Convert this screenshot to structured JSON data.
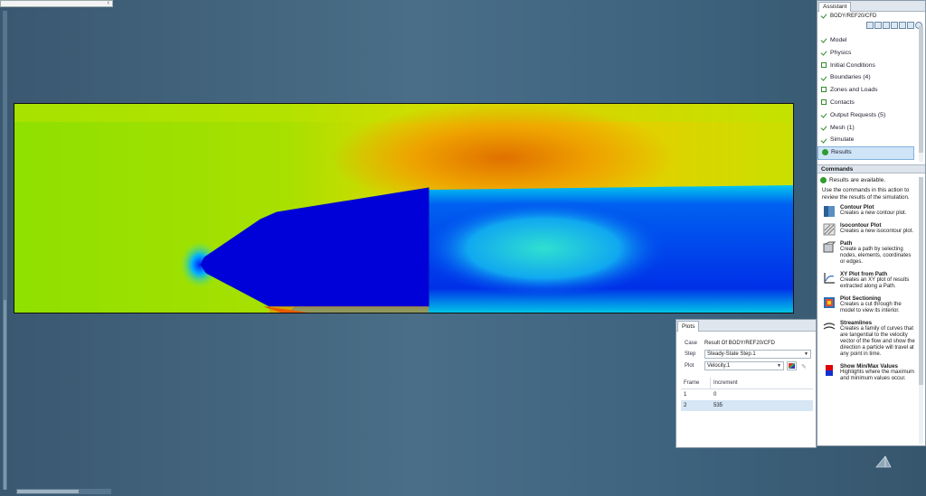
{
  "assistant": {
    "tab_label": "Assistant",
    "path": "BODY/REF20/CFD",
    "steps": [
      {
        "label": "Model",
        "state": "done"
      },
      {
        "label": "Physics",
        "state": "done"
      },
      {
        "label": "Initial Conditions",
        "state": "open"
      },
      {
        "label": "Boundaries (4)",
        "state": "done"
      },
      {
        "label": "Zones and Loads",
        "state": "open"
      },
      {
        "label": "Contacts",
        "state": "open"
      },
      {
        "label": "Output Requests (5)",
        "state": "done"
      },
      {
        "label": "Mesh (1)",
        "state": "done"
      },
      {
        "label": "Simulate",
        "state": "done"
      },
      {
        "label": "Results",
        "state": "active"
      }
    ],
    "commands_header": "Commands",
    "results_available": "Results are available.",
    "description": "Use the commands in this action to review the results of the simulation.",
    "commands": [
      {
        "title": "Contour Plot",
        "desc": "Creates a new contour plot.",
        "icon": "contour-plot-icon"
      },
      {
        "title": "Isocontour Plot",
        "desc": "Creates a new isocontour plot.",
        "icon": "isocontour-plot-icon"
      },
      {
        "title": "Path",
        "desc": "Create a path by selecting nodes, elements, coordinates or edges.",
        "icon": "path-icon"
      },
      {
        "title": "XY Plot from Path",
        "desc": "Creates an XY plot of results extracted along a Path.",
        "icon": "xy-plot-icon"
      },
      {
        "title": "Plot Sectioning",
        "desc": "Creates a cut through the model to view its interior.",
        "icon": "plot-sectioning-icon"
      },
      {
        "title": "Streamlines",
        "desc": "Creates a family of curves that are tangential to the velocity vector of the flow and show the direction a particle will travel at any point in time.",
        "icon": "streamlines-icon"
      },
      {
        "title": "Show Min/Max Values",
        "desc": "Highlights where the maximum and minimum values occur.",
        "icon": "min-max-icon"
      }
    ]
  },
  "plots": {
    "tab_label": "Plots",
    "case_label": "Case",
    "case_value": "Result Of BODY/REF20/CFD",
    "step_label": "Step",
    "step_value": "Steady-State Step.1",
    "plot_label": "Plot",
    "plot_value": "Velocity.1",
    "frame_header": "Frame",
    "increment_header": "Increment",
    "frames": [
      {
        "frame": "1",
        "increment": "0"
      },
      {
        "frame": "2",
        "increment": "535"
      }
    ]
  },
  "colors": {
    "done_check": "#2e8b2e",
    "selection": "#cfe4f7",
    "contour_min": "#0000d8",
    "contour_max": "#e02000"
  }
}
